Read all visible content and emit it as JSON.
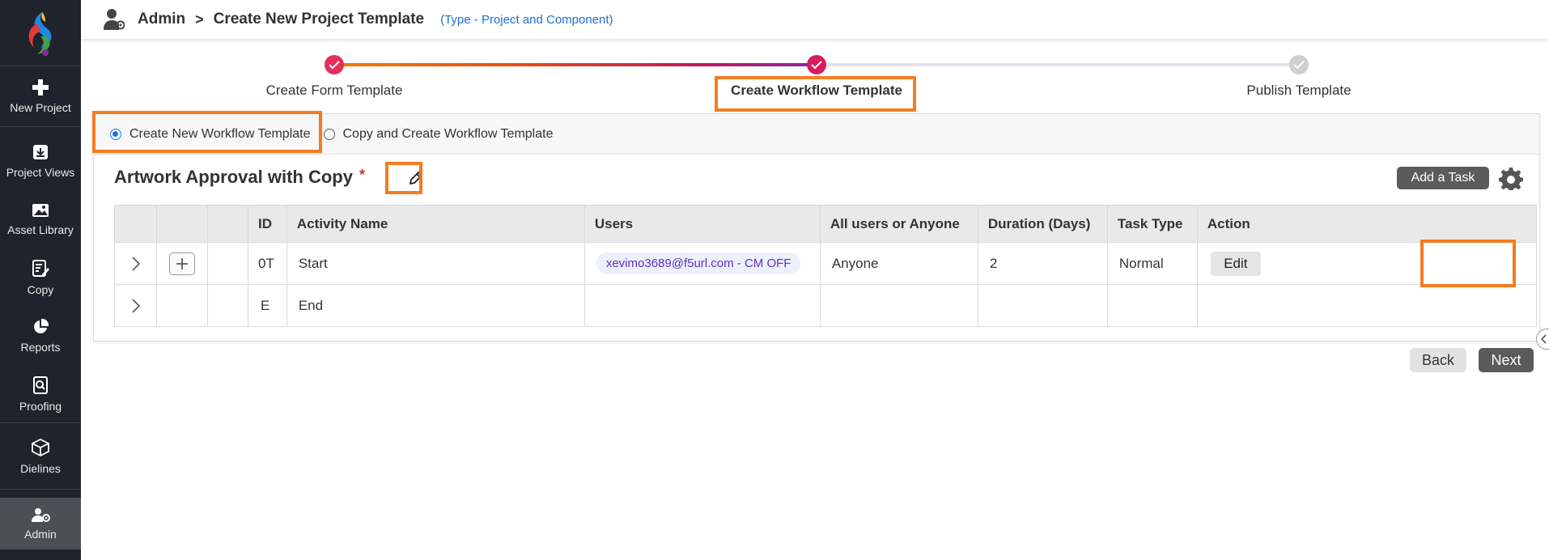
{
  "sidebar": {
    "items": [
      {
        "label": "New Project",
        "icon": "plus-icon"
      },
      {
        "label": "Project Views",
        "icon": "download-box-icon"
      },
      {
        "label": "Asset Library",
        "icon": "image-icon"
      },
      {
        "label": "Copy",
        "icon": "edit-document-icon"
      },
      {
        "label": "Reports",
        "icon": "pie-chart-icon"
      },
      {
        "label": "Proofing",
        "icon": "search-document-icon"
      },
      {
        "label": "Dielines",
        "icon": "box-icon"
      },
      {
        "label": "Admin",
        "icon": "admin-user-icon"
      }
    ],
    "active": "Admin",
    "colors": {
      "background": "#1f242c",
      "active": "#4b5057"
    }
  },
  "header": {
    "crumb_root": "Admin",
    "separator": ">",
    "crumb_page": "Create New Project Template",
    "type_note": "(Type - Project and Component)"
  },
  "stepper": {
    "steps": [
      {
        "label": "Create Form Template",
        "status": "done"
      },
      {
        "label": "Create Workflow Template",
        "status": "current"
      },
      {
        "label": "Publish Template",
        "status": "pending"
      }
    ]
  },
  "radio_options": [
    {
      "label": "Create New Workflow Template",
      "selected": true
    },
    {
      "label": "Copy and Create Workflow Template",
      "selected": false
    }
  ],
  "workflow": {
    "title": "Artwork Approval with Copy",
    "required_mark": "*",
    "add_task_label": "Add a Task"
  },
  "table": {
    "columns": [
      "",
      "",
      "",
      "ID",
      "Activity Name",
      "Users",
      "All users or Anyone",
      "Duration (Days)",
      "Task Type",
      "Action"
    ],
    "rows": [
      {
        "id": "0T",
        "activity": "Start",
        "users": "xevimo3689@f5url.com - CM OFF",
        "all_or_anyone": "Anyone",
        "duration": "2",
        "task_type": "Normal",
        "action": "Edit"
      },
      {
        "id": "E",
        "activity": "End",
        "users": "",
        "all_or_anyone": "",
        "duration": "",
        "task_type": "",
        "action": ""
      }
    ]
  },
  "footer": {
    "back_label": "Back",
    "next_label": "Next"
  },
  "colors": {
    "highlight": "#f47c20",
    "accent_link": "#1a6fd0",
    "step_done": "#d81b60",
    "radio": "#1a73e8",
    "button_dark": "#5b5b5b"
  }
}
